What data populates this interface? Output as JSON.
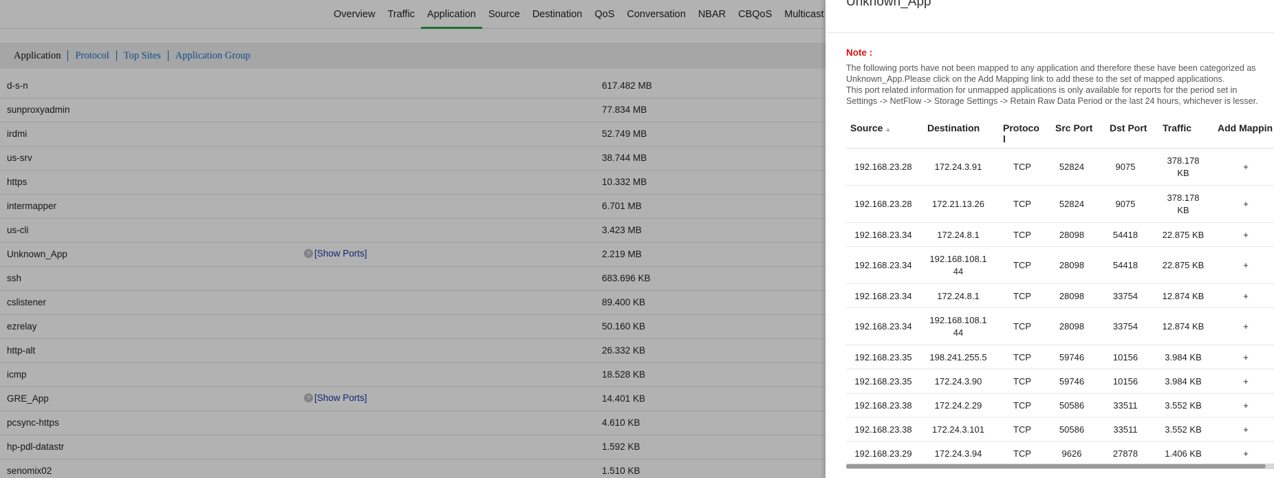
{
  "nav": {
    "items": [
      "Overview",
      "Traffic",
      "Application",
      "Source",
      "Destination",
      "QoS",
      "Conversation",
      "NBAR",
      "CBQoS",
      "Multicast"
    ],
    "active": "Application"
  },
  "subtabs": [
    "Application",
    "Protocol",
    "Top Sites",
    "Application Group"
  ],
  "apps": [
    {
      "name": "d-s-n",
      "size": "617.482 MB",
      "ports": ""
    },
    {
      "name": "sunproxyadmin",
      "size": "77.834 MB",
      "ports": ""
    },
    {
      "name": "irdmi",
      "size": "52.749 MB",
      "ports": ""
    },
    {
      "name": "us-srv",
      "size": "38.744 MB",
      "ports": ""
    },
    {
      "name": "https",
      "size": "10.332 MB",
      "ports": ""
    },
    {
      "name": "intermapper",
      "size": "6.701 MB",
      "ports": ""
    },
    {
      "name": "us-cli",
      "size": "3.423 MB",
      "ports": ""
    },
    {
      "name": "Unknown_App",
      "size": "2.219 MB",
      "ports": "[Show Ports]"
    },
    {
      "name": "ssh",
      "size": "683.696 KB",
      "ports": ""
    },
    {
      "name": "cslistener",
      "size": "89.400 KB",
      "ports": ""
    },
    {
      "name": "ezrelay",
      "size": "50.160 KB",
      "ports": ""
    },
    {
      "name": "http-alt",
      "size": "26.332 KB",
      "ports": ""
    },
    {
      "name": "icmp",
      "size": "18.528 KB",
      "ports": ""
    },
    {
      "name": "GRE_App",
      "size": "14.401 KB",
      "ports": "[Show Ports]"
    },
    {
      "name": "pcsync-https",
      "size": "4.610 KB",
      "ports": ""
    },
    {
      "name": "hp-pdl-datastr",
      "size": "1.592 KB",
      "ports": ""
    },
    {
      "name": "senomix02",
      "size": "1.510 KB",
      "ports": ""
    }
  ],
  "panel": {
    "title": "Unknown_App",
    "note_label": "Note :",
    "note_lines": [
      "The following ports have not been mapped to any application and therefore these have been categorized as",
      "Unknown_App.Please click on the Add Mapping link to add these to the set of mapped applications.",
      "This port related information for unmapped applications is only available for reports for the period set in",
      "Settings -> NetFlow -> Storage Settings -> Retain Raw Data Period or the last 24 hours, whichever is lesser."
    ],
    "headers": {
      "source": "Source",
      "destination": "Destination",
      "protocol_a": "Protoco",
      "protocol_b": "l",
      "src_port": "Src Port",
      "dst_port": "Dst Port",
      "traffic": "Traffic",
      "add_mapping": "Add Mappin"
    },
    "rows": [
      {
        "src": "192.168.23.28",
        "dst": [
          "172.24.3.91"
        ],
        "proto": "TCP",
        "sport": "52824",
        "dport": "9075",
        "traffic": [
          "378.178",
          "KB"
        ],
        "add": "+"
      },
      {
        "src": "192.168.23.28",
        "dst": [
          "172.21.13.26"
        ],
        "proto": "TCP",
        "sport": "52824",
        "dport": "9075",
        "traffic": [
          "378.178",
          "KB"
        ],
        "add": "+"
      },
      {
        "src": "192.168.23.34",
        "dst": [
          "172.24.8.1"
        ],
        "proto": "TCP",
        "sport": "28098",
        "dport": "54418",
        "traffic": [
          "22.875 KB"
        ],
        "add": "+"
      },
      {
        "src": "192.168.23.34",
        "dst": [
          "192.168.108.1",
          "44"
        ],
        "proto": "TCP",
        "sport": "28098",
        "dport": "54418",
        "traffic": [
          "22.875 KB"
        ],
        "add": "+"
      },
      {
        "src": "192.168.23.34",
        "dst": [
          "172.24.8.1"
        ],
        "proto": "TCP",
        "sport": "28098",
        "dport": "33754",
        "traffic": [
          "12.874 KB"
        ],
        "add": "+"
      },
      {
        "src": "192.168.23.34",
        "dst": [
          "192.168.108.1",
          "44"
        ],
        "proto": "TCP",
        "sport": "28098",
        "dport": "33754",
        "traffic": [
          "12.874 KB"
        ],
        "add": "+"
      },
      {
        "src": "192.168.23.35",
        "dst": [
          "198.241.255.5"
        ],
        "proto": "TCP",
        "sport": "59746",
        "dport": "10156",
        "traffic": [
          "3.984 KB"
        ],
        "add": "+"
      },
      {
        "src": "192.168.23.35",
        "dst": [
          "172.24.3.90"
        ],
        "proto": "TCP",
        "sport": "59746",
        "dport": "10156",
        "traffic": [
          "3.984 KB"
        ],
        "add": "+"
      },
      {
        "src": "192.168.23.38",
        "dst": [
          "172.24.2.29"
        ],
        "proto": "TCP",
        "sport": "50586",
        "dport": "33511",
        "traffic": [
          "3.552 KB"
        ],
        "add": "+"
      },
      {
        "src": "192.168.23.38",
        "dst": [
          "172.24.3.101"
        ],
        "proto": "TCP",
        "sport": "50586",
        "dport": "33511",
        "traffic": [
          "3.552 KB"
        ],
        "add": "+"
      },
      {
        "src": "192.168.23.29",
        "dst": [
          "172.24.3.94"
        ],
        "proto": "TCP",
        "sport": "9626",
        "dport": "27878",
        "traffic": [
          "1.406 KB"
        ],
        "add": "+"
      }
    ]
  }
}
